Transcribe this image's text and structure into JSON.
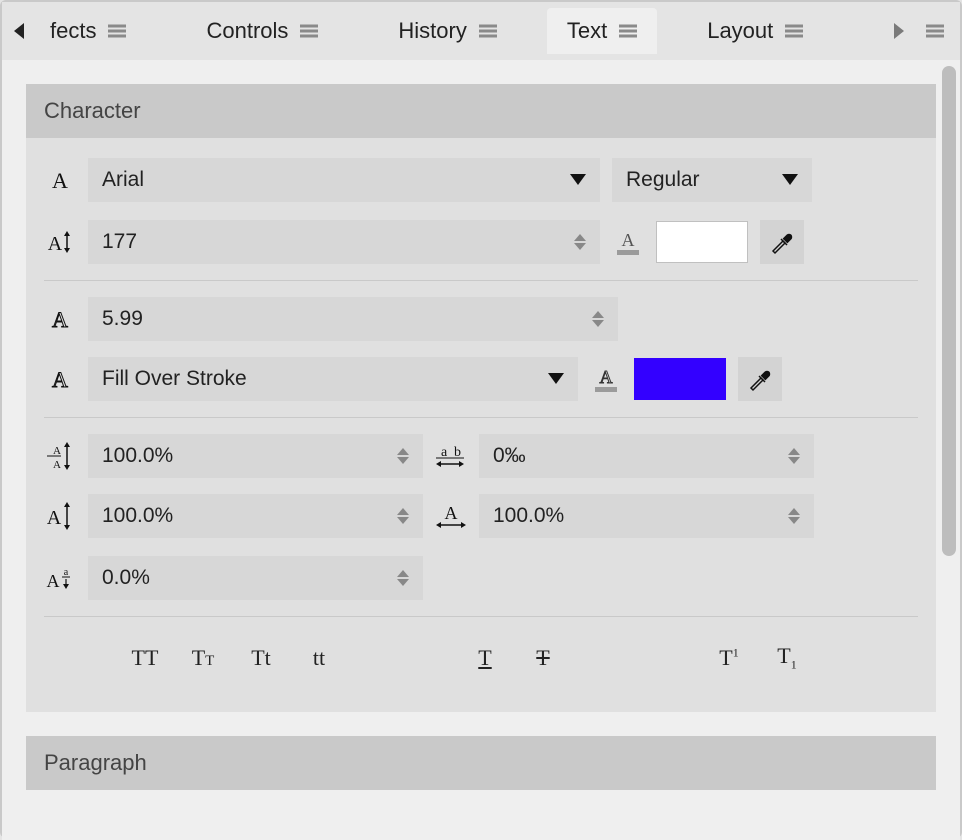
{
  "tabs": [
    {
      "label": "fects"
    },
    {
      "label": "Controls"
    },
    {
      "label": "History"
    },
    {
      "label": "Text"
    },
    {
      "label": "Layout"
    }
  ],
  "active_tab_index": 3,
  "panels": {
    "character": {
      "title": "Character",
      "font_family": "Arial",
      "font_style": "Regular",
      "font_size": "177",
      "stroke_width": "5.99",
      "fill_stroke_order": "Fill Over Stroke",
      "fill_color": "#ffffff",
      "stroke_color": "#3300ff",
      "line_height": "100.0%",
      "letter_spacing": "0‰",
      "vertical_scale": "100.0%",
      "horizontal_scale": "100.0%",
      "baseline_shift": "0.0%",
      "case_buttons": [
        "TT",
        "Tᴛ",
        "Tt",
        "tt"
      ],
      "deco_buttons": [
        "underline",
        "strikethrough"
      ],
      "script_buttons": [
        "superscript",
        "subscript"
      ]
    },
    "paragraph": {
      "title": "Paragraph"
    }
  }
}
